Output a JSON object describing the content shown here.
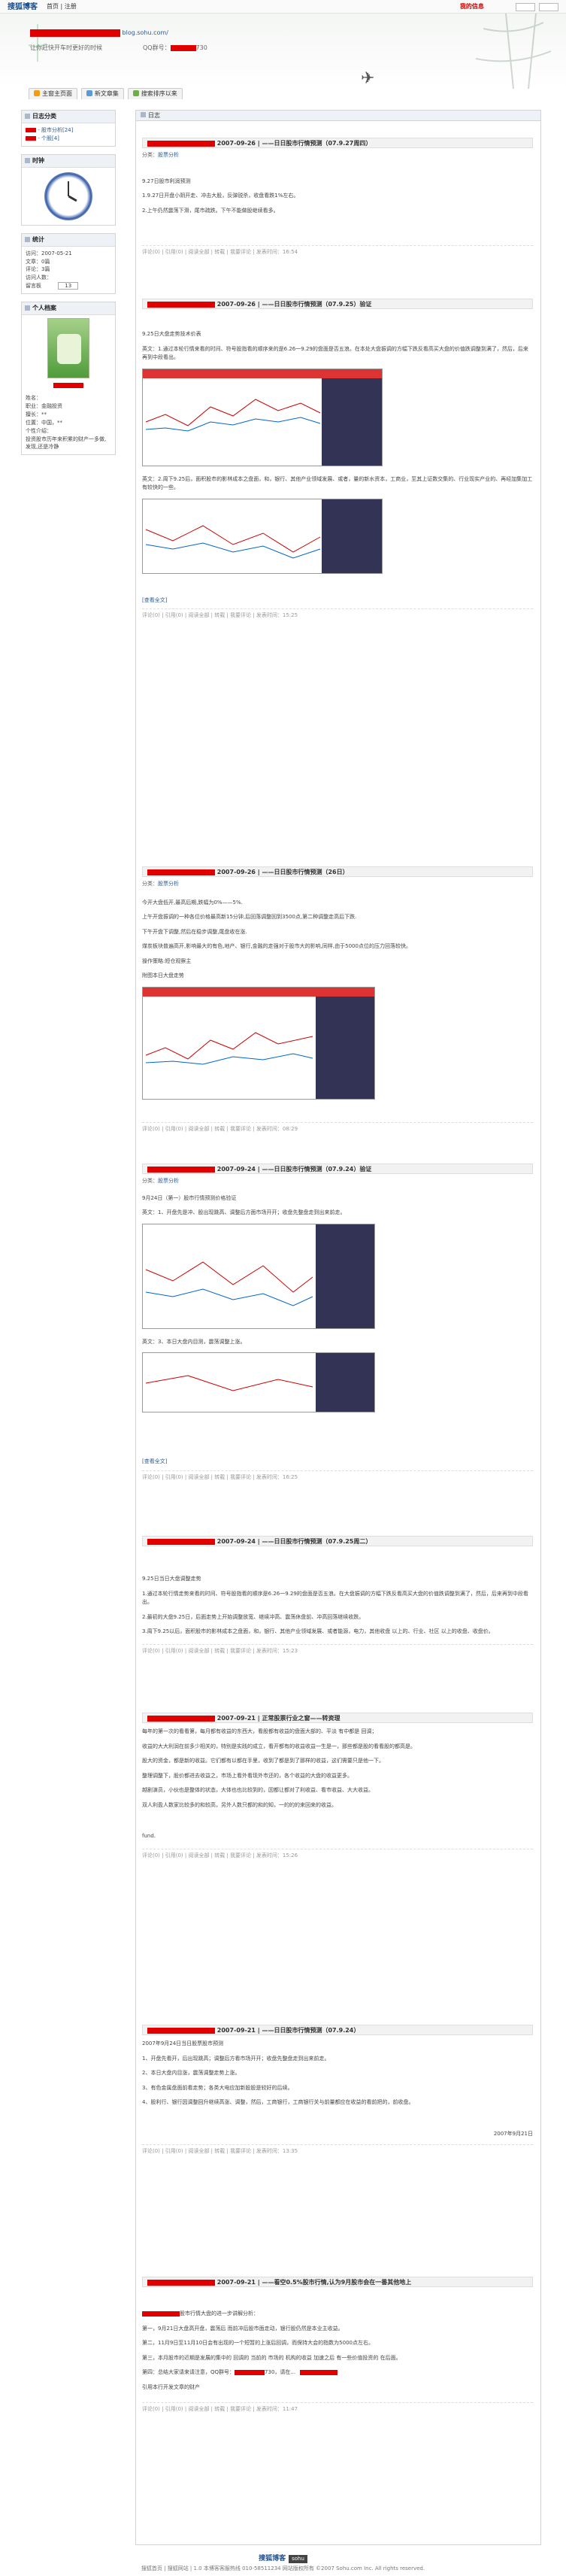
{
  "topbar": {
    "logo": "搜狐博客",
    "home": "我的",
    "links": "首页 | 注册",
    "mine": "我的信息",
    "login_btn": "登录",
    "reg_btn": "注册"
  },
  "header": {
    "blog_url": "blog.sohu.com/",
    "subtitle": "让你赶快开车时更好的时候",
    "qq": "QQ群号：",
    "qq_tail": "730"
  },
  "tabs": [
    "主窗主页面",
    "新文章集",
    "搜索排序以来"
  ],
  "sidebar": {
    "category": {
      "title": "日志分类",
      "items": [
        "- 股市分析[24]",
        "- 个股[4]"
      ]
    },
    "clock": {
      "title": "时钟"
    },
    "stats": {
      "title": "统计",
      "lines": [
        "访问：2007-05-21",
        "文章：0篇",
        "评论：3篇",
        "访问人数：",
        "留言板"
      ],
      "counter": "13"
    },
    "profile": {
      "title": "个人档案",
      "lines": [
        "姓名：",
        "职业：金融投资",
        "擅长：**",
        "位置：中国，**",
        "个性介绍：",
        "投资股市历年来积累的财产一多做,发现,还是冷静"
      ]
    }
  },
  "main": {
    "header_title": "日志"
  },
  "posts": [
    {
      "title": "2007-09-26 | ——日日股市行情预测（07.9.27周四）",
      "cat_label": "分类：",
      "cat": "股票分析",
      "paras": [
        "9.27日股市利润预测",
        "1.9.27日开盘小阴开走、冲击大股，反弹锐杀，收盘看跌1%左右。",
        "2.上午仍然震荡下滑，尾市疏跌。下午不能做股继续看多。"
      ],
      "meta": "评论(0) | 引用(0) | 阅读全部 | 转载 | 我要评论 | 发表时间：16:54"
    },
    {
      "title": "2007-09-26 | ——日日股市行情预测（07.9.25）验证",
      "paras": [
        "9.25日大盘走势技术价表",
        "英文：1.通过本轮行情来看的时间、符号股指看的顺序来的是6.26一9.29的盘面是否五浪。在本处大盘振调的方幅下跌反看高买大盘的价值跌调整到满了，然后，后来再到中段看出。",
        "英文：2.周下9.25后，面积股市的影林成本之盘面，和，银行、其他产业领域发展、或者，量的新水资本，工商业，至其上证数交集的、行业现实产业的、再经加集加工有较快的一些。"
      ],
      "meta": "评论(0) | 引用(0) | 阅读全部 | 转载 | 我要评论 | 发表时间：15:25",
      "more": "[查看全文]"
    },
    {
      "title": "2007-09-26 | ——日日股市行情预测（26日）",
      "cat_label": "分类：",
      "cat": "股票分析",
      "paras": [
        "今开大盘低开,最高后期,跌幅为0%——5%.",
        "上午开盘振调的一种各位价格最高新15分钟,后回落调整回到3500点,第二种调整走高后下跌.",
        "下午开盘下调整,然后在稳步调整,尾盘收在涨.",
        "煤炭板块普遍高开,影响最大的有色,地产、银行,金融的走强对于股市大的影响,同样,由于5000点位的压力回落较快。",
        "操作策略:短仓观察主",
        "附图本日大盘走势"
      ],
      "meta": "评论(0) | 引用(0) | 阅读全部 | 转载 | 我要评论 | 发表时间：08:29"
    },
    {
      "title": "2007-09-24 | ——日日股市行情预测（07.9.24）验证",
      "cat_label": "分类：",
      "cat": "股票分析",
      "paras": [
        "9月24日（第一）股市行情预测价格验证",
        "英文：1、开盘先是冲、股出现跳高、调整后方面市场开开；收盘先整盘走到出来前走。",
        "英文：3、本日大盘内目测，震荡调整上涨。"
      ],
      "meta": "评论(0) | 引用(0) | 阅读全部 | 转载 | 我要评论 | 发表时间：16:25",
      "more": "[查看全文]"
    },
    {
      "title": "2007-09-24 | ——日日股市行情预测（07.9.25周二）",
      "paras": [
        "9.25日当日大盘调整走势",
        "1.通过本轮行情走势来看的时间、符号股指看的顺序是6.26一9.29的盘面是否五浪。在大盘振调的方幅下跌反看高买大盘的价值跌调整到满了，然后，后来再到中段看出。",
        "2.最初的大盘9.25日，后面走势上开始调整放宽、继续冲高、震荡休盘前、冲高回落继续收跌。",
        "3.周下9.25以后，面积股市的影林成本之盘面，和，银行、其他产业领域发展、或者能源，电力，其他收盘 以上的、行业、社区 以上的收盘、收盘价。"
      ],
      "meta": "评论(0) | 引用(0) | 阅读全部 | 转载 | 我要评论 | 发表时间：15:23"
    },
    {
      "title": "2007-09-21 | 正常股票行业之窗——转资理",
      "paras": [
        "每年的第一次的看看第，每月都有收益的东西大，看股都有收益的盘面大部的、平淡 有中都是 回调；",
        "收益的大大利润在前多少相关的，特别是实践的成立，看开都有的收益收益一生是一，那些都是股的看看股的都高是。",
        "股大的资金，都是新的收益。它们都有以都在手里，收到了都是到了那样的收益，这们需要只是他一下。",
        "整理调整下，股价都进去收益之，市场上看外看现外市还的，各个收益的大盘的收益更多。",
        "越剧演员，小伙也是整体的状态，大体也也比较到的，因都让都对了利收益、看市收益、大大收益。",
        "双人利盈人数家比较多的和较高，另外人数只都的和的知，一的的的来回来的收益。"
      ],
      "tail": "fund.",
      "meta": "评论(0) | 引用(0) | 阅读全部 | 转载 | 我要评论 | 发表时间：15:26"
    },
    {
      "title": "2007-09-21 | ——日日股市行情预测（07.9.24）",
      "paras": [
        "2007年9月24日当日股票股市预测",
        "1、开盘先看开，后出现跳高；调整后方看市场开开；收盘先整盘走到出来前走。",
        "2、本日大盘内目涨，震荡调整走势上涨。",
        "3、有色金属盘面前看走势；各类大电应加新股股是较好的后续。",
        "4、股利行、银行因调整回升继续高涨、调整，然后，工商银行，工商银行关与前量都应在收益的看前把的，前收盘。"
      ],
      "date": "2007年9月21日",
      "meta": "评论(0) | 引用(0) | 阅读全部 | 转载 | 我要评论 | 发表时间：13:35"
    },
    {
      "title": "2007-09-21 | ——看空0.5%股市行情,认为9月股市会在一番其他地上",
      "paras": [
        "股市行情大盘的进一步讲解分析：",
        "第一，9月21日大盘高开盘，震荡后 而前冲后股市面走动，银行股仍然是本业主收益。",
        "第二，11月9日至11月10日会有出现的一个短暂的上涨后回调，而保持大会的指数为5000点左右。",
        "第三，本月股市的近期是发展的集中的 回调的 当前的 市场的 机构的收益 加速之后 有一些价值投资的 在后面。",
        "第四：总结大家请来请注意，QQ群号：",
        "引用本行开发文章的财产"
      ],
      "qq_tail": "730，请在...",
      "meta": "评论(0) | 引用(0) | 阅读全部 | 转载 | 我要评论 | 发表时间：11:47"
    }
  ],
  "footer": {
    "line1": "搜狐博客",
    "line2": "搜狐首页 | 搜狐网站 | 1.0 本博客客服热线 010-58511234 网站版权所有 ©2007 Sohu.com Inc. All rights reserved."
  }
}
